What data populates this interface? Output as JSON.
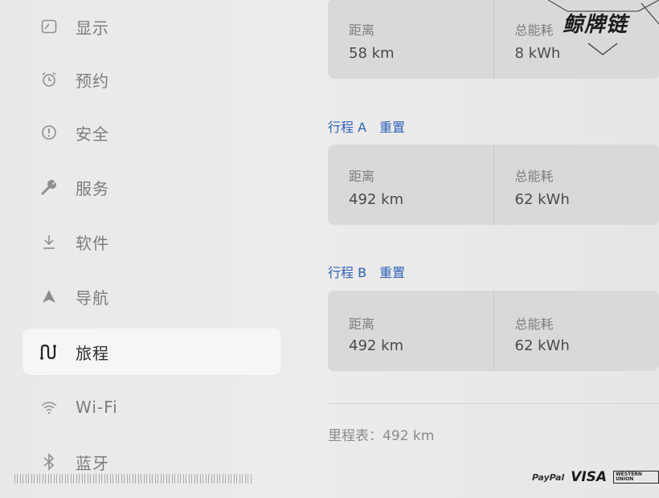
{
  "sidebar": {
    "items": [
      {
        "label": "显示",
        "icon": "display-icon"
      },
      {
        "label": "预约",
        "icon": "alarm-clock-icon"
      },
      {
        "label": "安全",
        "icon": "alert-circle-icon"
      },
      {
        "label": "服务",
        "icon": "wrench-icon"
      },
      {
        "label": "软件",
        "icon": "download-icon"
      },
      {
        "label": "导航",
        "icon": "navigation-arrow-icon"
      },
      {
        "label": "旅程",
        "icon": "trips-icon",
        "active": true
      },
      {
        "label": "Wi-Fi",
        "icon": "wifi-icon"
      },
      {
        "label": "蓝牙",
        "icon": "bluetooth-icon"
      }
    ]
  },
  "main": {
    "current": {
      "distance_label": "距离",
      "distance_value": "58 km",
      "energy_label": "总能耗",
      "energy_value": "8 kWh"
    },
    "trip_a": {
      "title": "行程 A",
      "reset": "重置",
      "distance_label": "距离",
      "distance_value": "492 km",
      "energy_label": "总能耗",
      "energy_value": "62 kWh"
    },
    "trip_b": {
      "title": "行程 B",
      "reset": "重置",
      "distance_label": "距离",
      "distance_value": "492 km",
      "energy_label": "总能耗",
      "energy_value": "62 kWh"
    },
    "odometer": "里程表：492 km"
  },
  "overlay": {
    "watermark": "鲸牌链",
    "payments": {
      "paypal": "PayPal",
      "visa": "VISA",
      "western_union": "WESTERN UNION"
    }
  },
  "colors": {
    "link": "#2f62b8",
    "card": "#d9d9d9",
    "active_bg": "#f6f6f6"
  }
}
